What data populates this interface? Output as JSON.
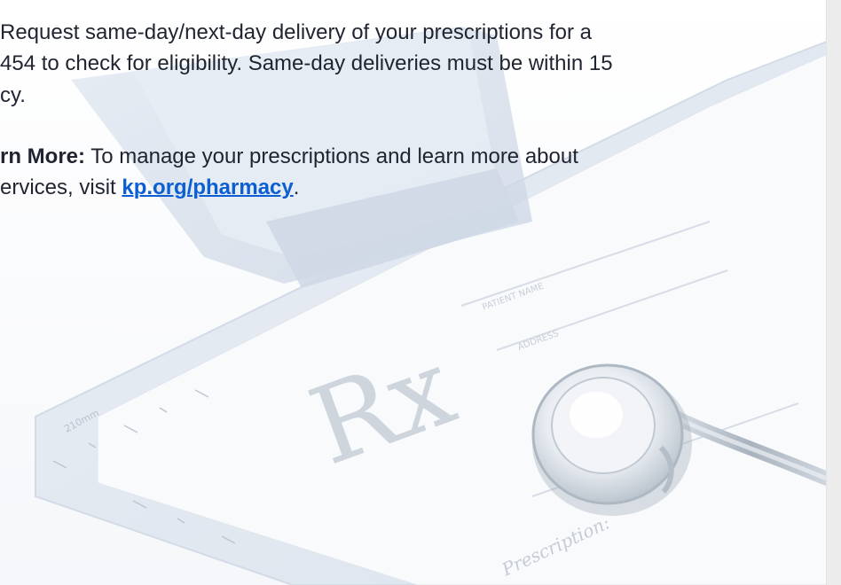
{
  "delivery_text": {
    "line1": " Request same-day/next-day delivery of your prescriptions for a",
    "line2": "454 to check for eligibility. Same-day deliveries must be within 15",
    "line3": "cy."
  },
  "learn_more": {
    "label": "rn More:",
    "line1_text": " To manage your prescriptions and learn more about",
    "line2_text": "ervices, visit ",
    "link_text": "kp.org/pharmacy",
    "link_suffix": "."
  },
  "hero_image": {
    "rx_label": "Rx",
    "ruler_label": "210mm",
    "patient_name_label": "PATIENT NAME",
    "address_label": "ADDRESS",
    "prescription_label": "Prescription:"
  },
  "colors": {
    "text": "#1f2430",
    "link": "#0b5fd3",
    "scrollbar": "#ececec"
  }
}
